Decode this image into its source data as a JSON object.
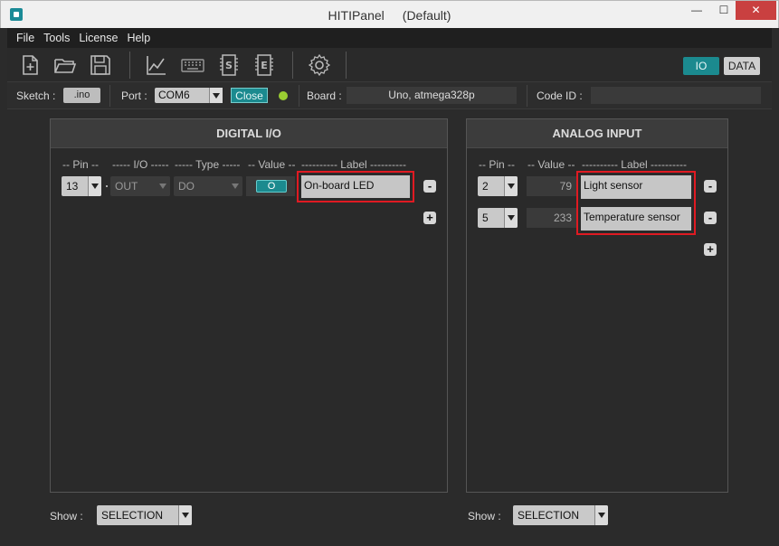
{
  "window": {
    "title": "HITIPanel",
    "subtitle": "(Default)",
    "min_glyph": "—",
    "max_glyph": "☐",
    "close_glyph": "✕"
  },
  "menu": [
    "File",
    "Tools",
    "License",
    "Help"
  ],
  "toolbar": {
    "icons": [
      "new-file-icon",
      "open-folder-icon",
      "save-icon",
      "chart-icon",
      "keyboard-icon",
      "serial-s-icon",
      "eeprom-e-icon",
      "settings-gear-icon"
    ],
    "mode_io": "IO",
    "mode_data": "DATA"
  },
  "infobar": {
    "sketch_label": "Sketch :",
    "sketch_button": ".ino",
    "port_label": "Port :",
    "port_value": "COM6",
    "close_button": "Close",
    "board_label": "Board :",
    "board_value": "Uno, atmega328p",
    "code_id_label": "Code ID :",
    "code_id_value": ""
  },
  "digital": {
    "title": "DIGITAL  I/O",
    "headers": {
      "pin": "-- Pin --",
      "io": "----- I/O -----",
      "type": "----- Type -----",
      "value": "-- Value --",
      "label": "---------- Label ----------"
    },
    "rows": [
      {
        "pin": "13",
        "io": "OUT",
        "type": "DO",
        "value": "O",
        "label": "On-board LED"
      }
    ],
    "remove": "-",
    "add": "+",
    "show_label": "Show :",
    "show_value": "SELECTION"
  },
  "analog": {
    "title": "ANALOG  INPUT",
    "headers": {
      "pin": "-- Pin --",
      "value": "-- Value --",
      "label": "---------- Label ----------"
    },
    "rows": [
      {
        "pin": "2",
        "value": "79",
        "label": "Light sensor"
      },
      {
        "pin": "5",
        "value": "233",
        "label": "Temperature sensor"
      }
    ],
    "remove": "-",
    "add": "+",
    "show_label": "Show :",
    "show_value": "SELECTION"
  },
  "colors": {
    "accent": "#1b8a8f",
    "highlight": "#e01a22",
    "status_led": "#9acd32"
  }
}
